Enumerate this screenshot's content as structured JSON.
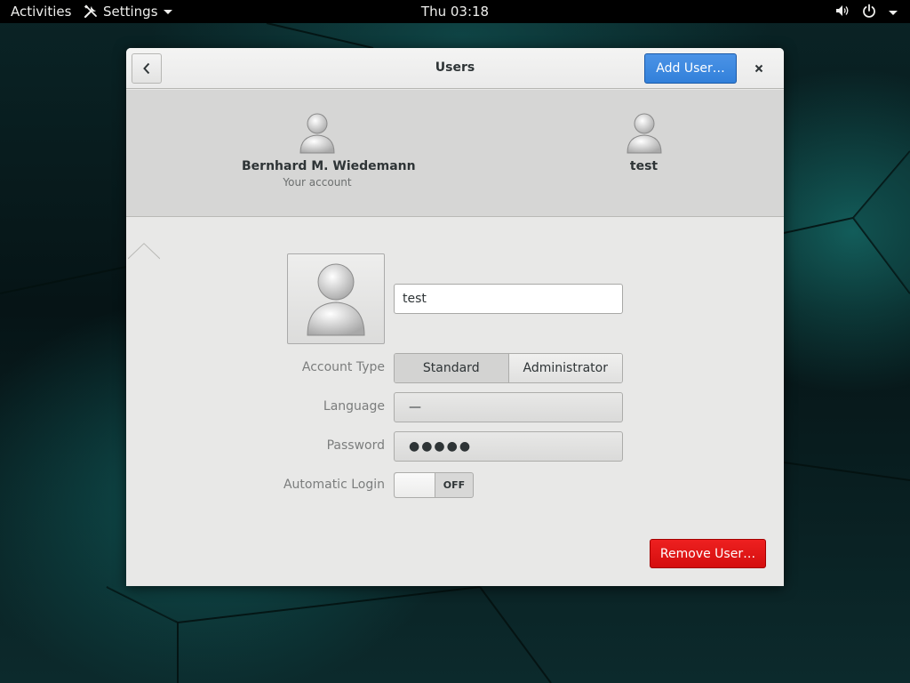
{
  "topbar": {
    "activities": "Activities",
    "app_menu": "Settings",
    "clock": "Thu 03:18"
  },
  "window": {
    "title": "Users",
    "add_user": "Add User…",
    "remove_user": "Remove User…"
  },
  "accounts": [
    {
      "name": "Bernhard M. Wiedemann",
      "subtitle": "Your account"
    },
    {
      "name": "test",
      "subtitle": ""
    }
  ],
  "details": {
    "full_name": "test",
    "account_type_label": "Account Type",
    "account_type_options": [
      "Standard",
      "Administrator"
    ],
    "account_type_selected": "Standard",
    "language_label": "Language",
    "language_value": "—",
    "password_label": "Password",
    "password_value": "●●●●●",
    "auto_login_label": "Automatic Login",
    "auto_login_state": "OFF"
  },
  "colors": {
    "accent": "#3a86dc",
    "destructive": "#e21717"
  }
}
